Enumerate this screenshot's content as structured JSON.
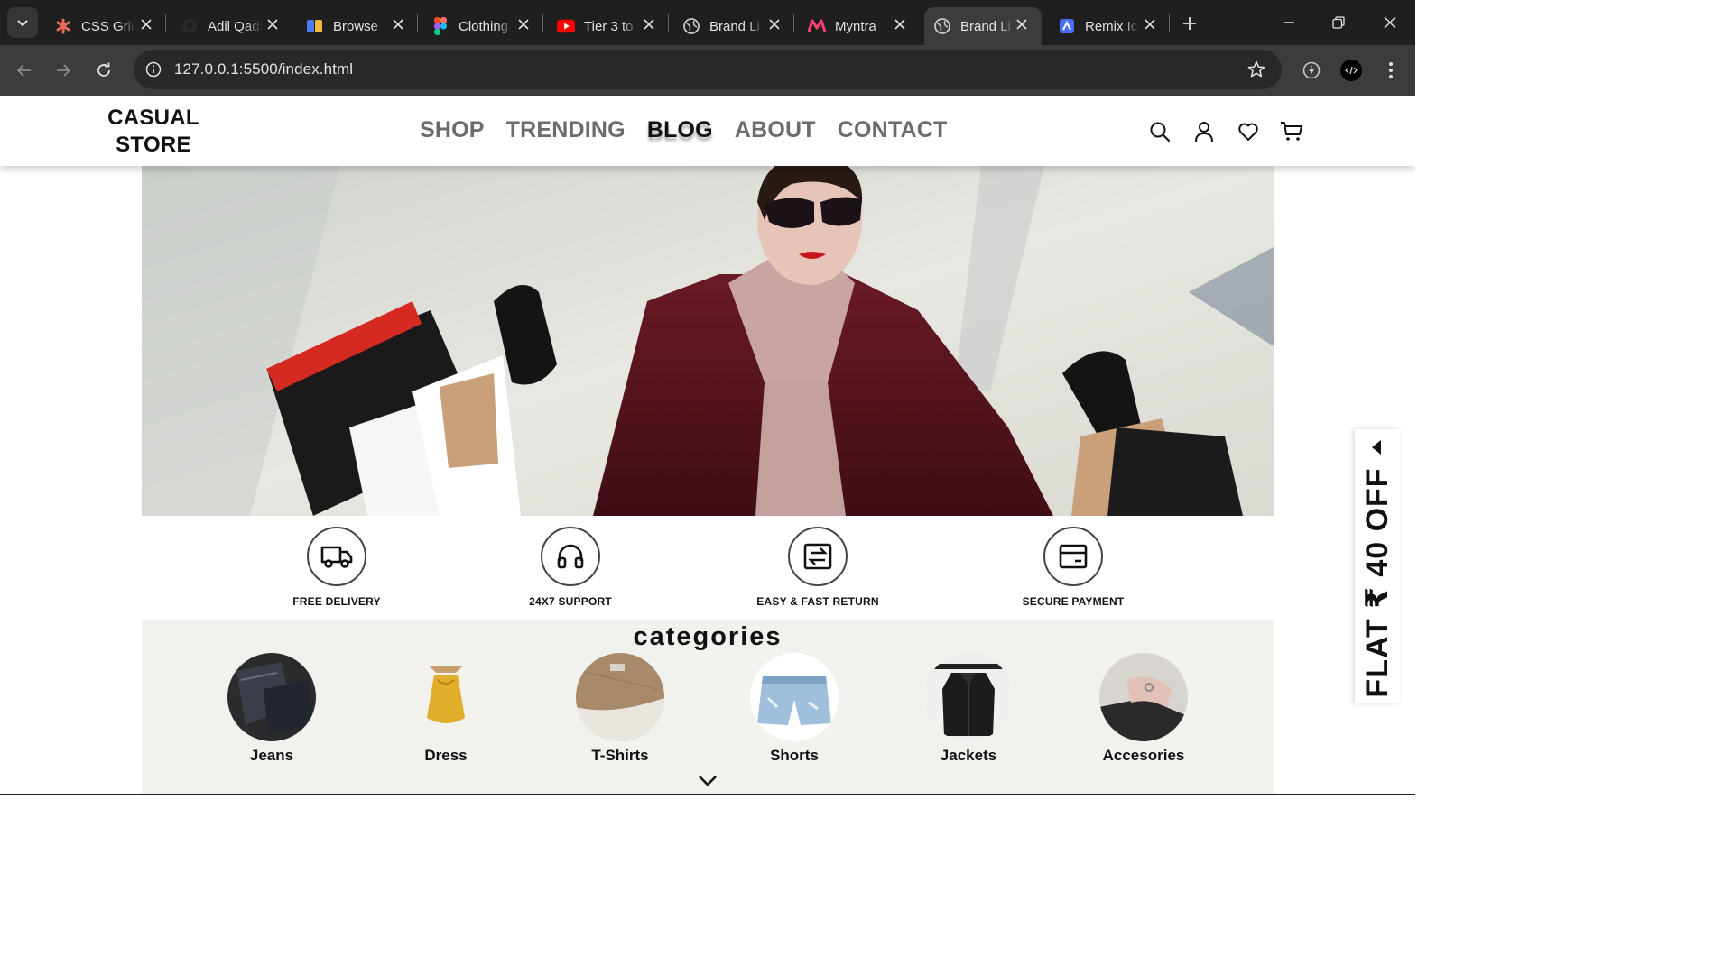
{
  "browser": {
    "tabs": [
      {
        "title": "CSS Grid",
        "icon": "figma-asterisk-icon"
      },
      {
        "title": "Adil Qadri",
        "icon": "github-icon"
      },
      {
        "title": "Browse",
        "icon": "logo-icon"
      },
      {
        "title": "Clothing",
        "icon": "figma-icon"
      },
      {
        "title": "Tier 3 to",
        "icon": "youtube-icon"
      },
      {
        "title": "Brand Li",
        "icon": "globe-icon"
      },
      {
        "title": "Myntra",
        "icon": "myntra-icon"
      },
      {
        "title": "Brand Li",
        "icon": "globe-icon"
      },
      {
        "title": "Remix Ic",
        "icon": "remix-icon"
      }
    ],
    "active_tab_index": 7,
    "url": "127.0.0.1:5500/index.html"
  },
  "site": {
    "logo": {
      "line1": "CASUAL",
      "line2": "STORE"
    },
    "nav": [
      {
        "label": "SHOP"
      },
      {
        "label": "TRENDING"
      },
      {
        "label": "BLOG"
      },
      {
        "label": "ABOUT"
      },
      {
        "label": "CONTACT"
      }
    ],
    "active_nav": "BLOG"
  },
  "features": [
    {
      "label": "FREE DELIVERY",
      "icon": "truck-icon"
    },
    {
      "label": "24X7 SUPPORT",
      "icon": "headphones-icon"
    },
    {
      "label": "EASY & FAST RETURN",
      "icon": "exchange-icon"
    },
    {
      "label": "SECURE PAYMENT",
      "icon": "card-icon"
    }
  ],
  "categories": {
    "title": "categories",
    "items": [
      {
        "label": "Jeans"
      },
      {
        "label": "Dress"
      },
      {
        "label": "T-Shirts"
      },
      {
        "label": "Shorts"
      },
      {
        "label": "Jackets"
      },
      {
        "label": "Accesories"
      }
    ]
  },
  "offer": {
    "text": "FLAT ₹ 40 OFF"
  },
  "colors": {
    "chrome_dark": "#1f1f1f",
    "chrome_toolbar": "#3c3c3c",
    "page_bg": "#ffffff",
    "categories_bg": "#f1f1ee",
    "coat": "#5b1420"
  }
}
